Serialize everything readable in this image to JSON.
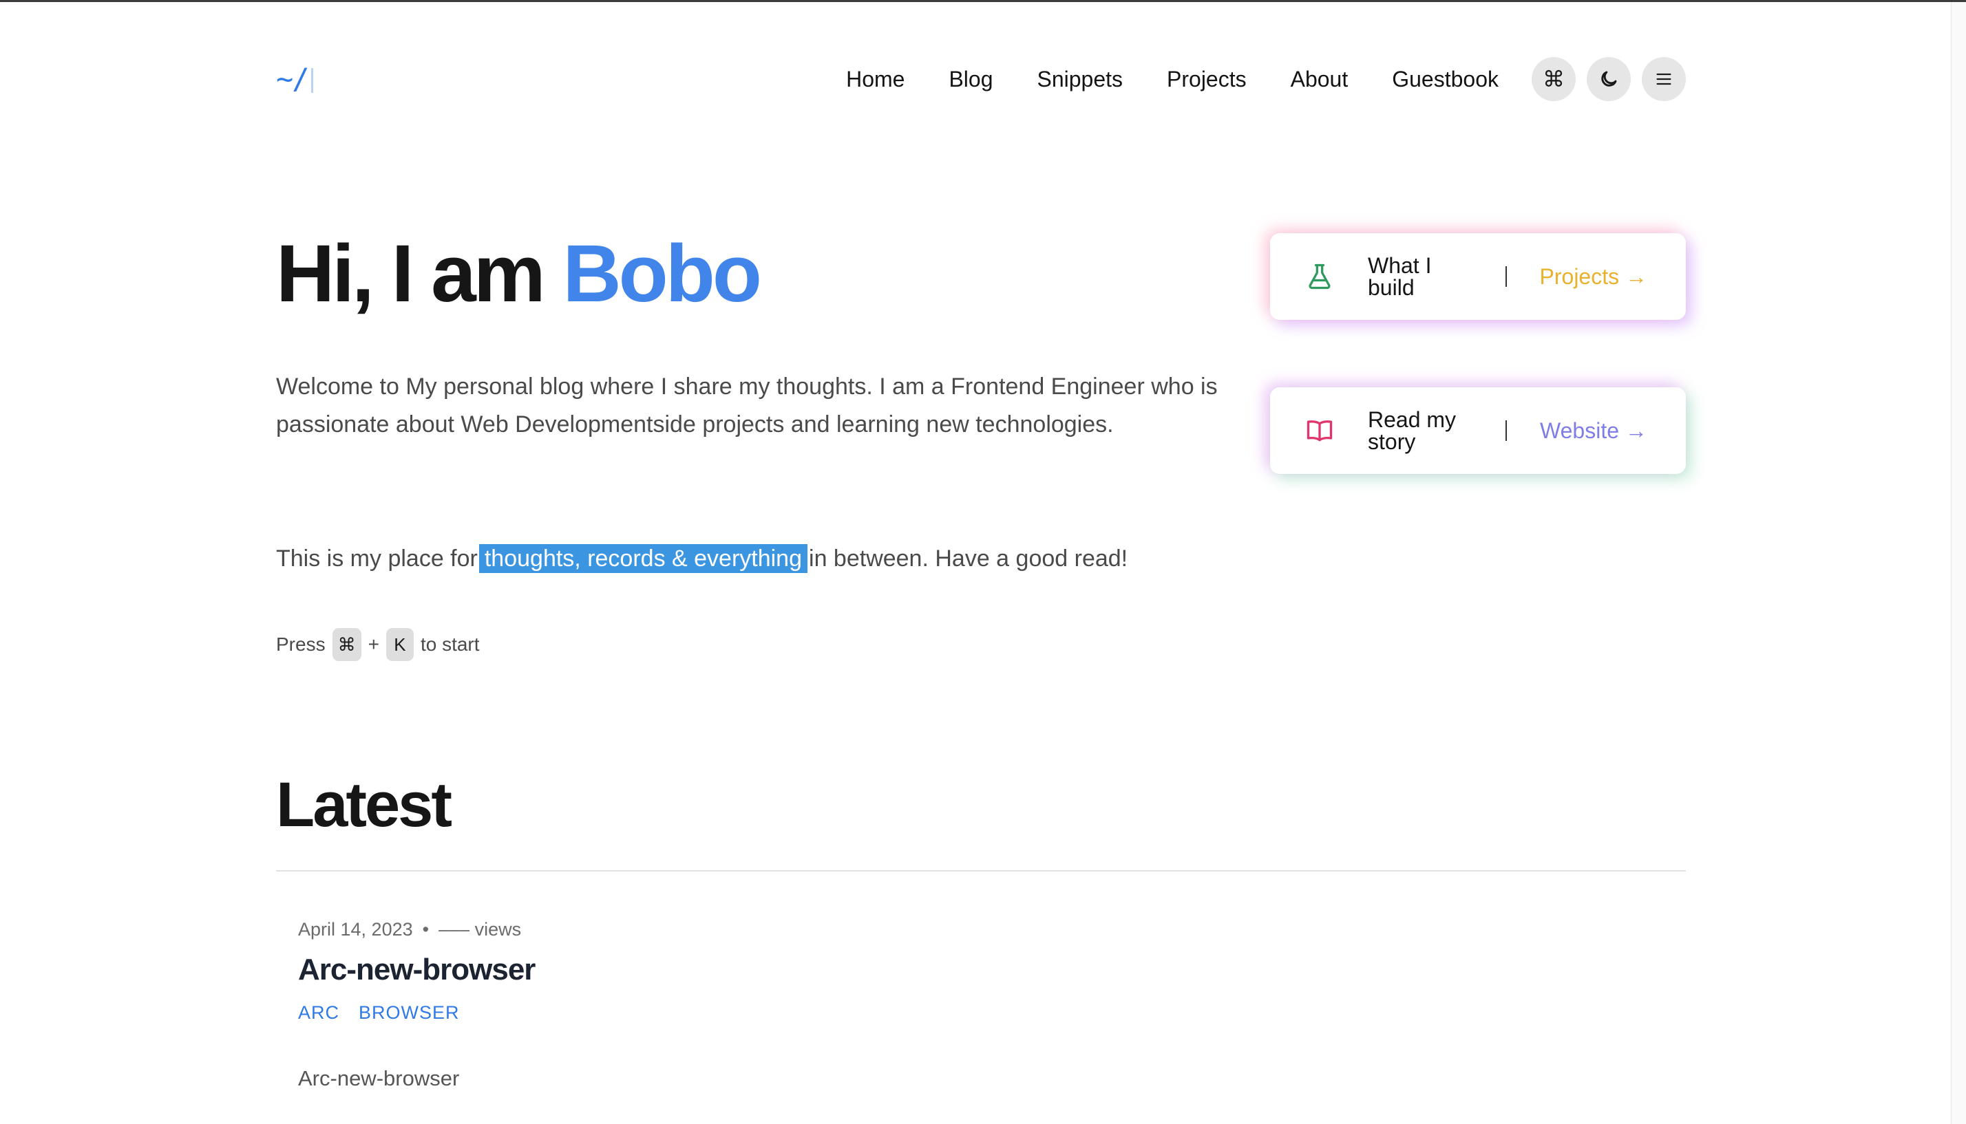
{
  "header": {
    "logo": "~/",
    "nav": [
      "Home",
      "Blog",
      "Snippets",
      "Projects",
      "About",
      "Guestbook"
    ],
    "buttons": [
      {
        "icon": "command-icon",
        "glyph": "⌘"
      },
      {
        "icon": "moon-icon"
      },
      {
        "icon": "menu-icon"
      }
    ]
  },
  "hero": {
    "title_prefix": "Hi, I am ",
    "title_name": "Bobo",
    "intro": "Welcome to My personal blog where I share my thoughts. I am a Frontend Engineer who is passionate about Web Developmentside projects and learning new technologies.",
    "place_before": "This is my place for",
    "place_highlight": "thoughts, records & everything",
    "place_after": "in between. Have a good read!",
    "press_label": "Press",
    "press_key1": "⌘",
    "press_plus": "+",
    "press_key2": "K",
    "press_suffix": "to start"
  },
  "cards": [
    {
      "icon": "flask-icon",
      "label": "What I build",
      "link": "Projects →",
      "color": "#e8b22e"
    },
    {
      "icon": "book-icon",
      "label": "Read my story",
      "link": "Website →",
      "color": "#7e7ee6"
    }
  ],
  "latest": {
    "heading": "Latest",
    "posts": [
      {
        "date": "April 14, 2023",
        "bullet": "•",
        "views": "––– views",
        "title": "Arc-new-browser",
        "tags": [
          "ARC",
          "BROWSER"
        ],
        "excerpt": "Arc-new-browser"
      }
    ]
  },
  "colors": {
    "accent": "#4185ea",
    "highlight": "#3b95e0",
    "projects_link": "#e8b22e",
    "website_link": "#7e7ee6"
  }
}
